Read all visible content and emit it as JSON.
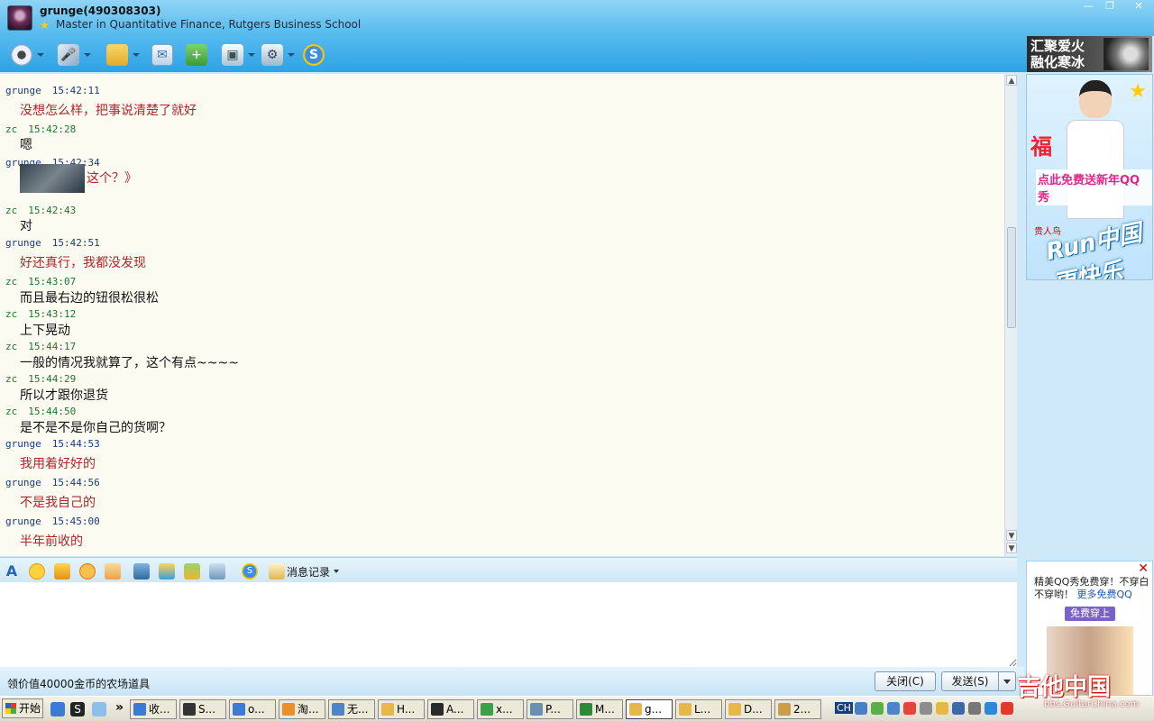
{
  "window": {
    "title": "grunge(490308303)",
    "signature": "Master in Quantitative Finance, Rutgers Business School",
    "controls": [
      "—",
      "❐",
      "✕"
    ]
  },
  "toolbar": {
    "items": [
      {
        "name": "video-call",
        "icon": "webcam-icon",
        "color": "#f0f4f8",
        "dropdown": true
      },
      {
        "name": "voice-call",
        "icon": "microphone-icon",
        "color": "#e8eef6",
        "dropdown": true
      },
      {
        "name": "send-file",
        "icon": "folder-icon",
        "color": "#f4c542",
        "dropdown": true
      },
      {
        "name": "send-mail",
        "icon": "mail-icon",
        "color": "#e8f2fa",
        "dropdown": false
      },
      {
        "name": "create-group",
        "icon": "group-add-icon",
        "color": "#54b84c",
        "dropdown": false
      },
      {
        "name": "app",
        "icon": "app-icon",
        "color": "#f4f7fa",
        "dropdown": true
      },
      {
        "name": "settings",
        "icon": "settings-icon",
        "color": "#e4ecf2",
        "dropdown": true
      },
      {
        "name": "soso",
        "icon": "s-logo-icon",
        "color": "#2f7fd8",
        "dropdown": false
      }
    ]
  },
  "ads": {
    "top_line1": "汇聚爱火",
    "top_line2": "融化寒冰",
    "side_text": "点此免费送新年QQ秀",
    "side_run": "Run中国",
    "side_run2": "更快乐",
    "side_brand": "贵人鸟",
    "side_fu": "福",
    "small_text": "精美QQ秀免费穿！不穿白不穿哟！",
    "small_more": "更多免费QQ",
    "small_button": "免费穿上",
    "small_close": "✕"
  },
  "chat": {
    "messages": [
      {
        "sender": "grunge",
        "time": "15:42:11",
        "text": "没想怎么样，把事说清楚了就好"
      },
      {
        "sender": "zc",
        "time": "15:42:28",
        "text": "嗯"
      },
      {
        "sender": "grunge",
        "time": "15:42:34",
        "text": "这个？》",
        "image": true
      },
      {
        "sender": "zc",
        "time": "15:42:43",
        "text": "对"
      },
      {
        "sender": "grunge",
        "time": "15:42:51",
        "text": "好还真行，我都没发现"
      },
      {
        "sender": "zc",
        "time": "15:43:07",
        "text": "而且最右边的钮很松很松"
      },
      {
        "sender": "zc",
        "time": "15:43:12",
        "text": "上下晃动"
      },
      {
        "sender": "zc",
        "time": "15:44:17",
        "text": "一般的情况我就算了，这个有点~~~~"
      },
      {
        "sender": "zc",
        "time": "15:44:29",
        "text": "所以才跟你退货"
      },
      {
        "sender": "zc",
        "time": "15:44:50",
        "text": "是不是不是你自己的货啊？"
      },
      {
        "sender": "grunge",
        "time": "15:44:53",
        "text": "我用着好好的"
      },
      {
        "sender": "grunge",
        "time": "15:44:56",
        "text": "不是我自己的"
      },
      {
        "sender": "grunge",
        "time": "15:45:00",
        "text": "半年前收的"
      }
    ]
  },
  "formatbar": {
    "font_icon": "A",
    "history_label": "消息记录"
  },
  "input": {
    "value": ""
  },
  "bottombar": {
    "promo_text": "领价值40000金币的农场道具",
    "close_label": "关闭(C)",
    "send_label": "发送(S)"
  },
  "taskbar": {
    "start_label": "开始",
    "chevron": "»",
    "tasks": [
      "收...",
      "S...",
      "o...",
      "淘...",
      "无...",
      "H...",
      "A...",
      "x...",
      "P...",
      "M...",
      "g...",
      "L...",
      "D...",
      "2..."
    ],
    "ime": "CH"
  },
  "watermark": {
    "main": "吉他中国",
    "sub": "bbs.GuitarChina.com"
  }
}
